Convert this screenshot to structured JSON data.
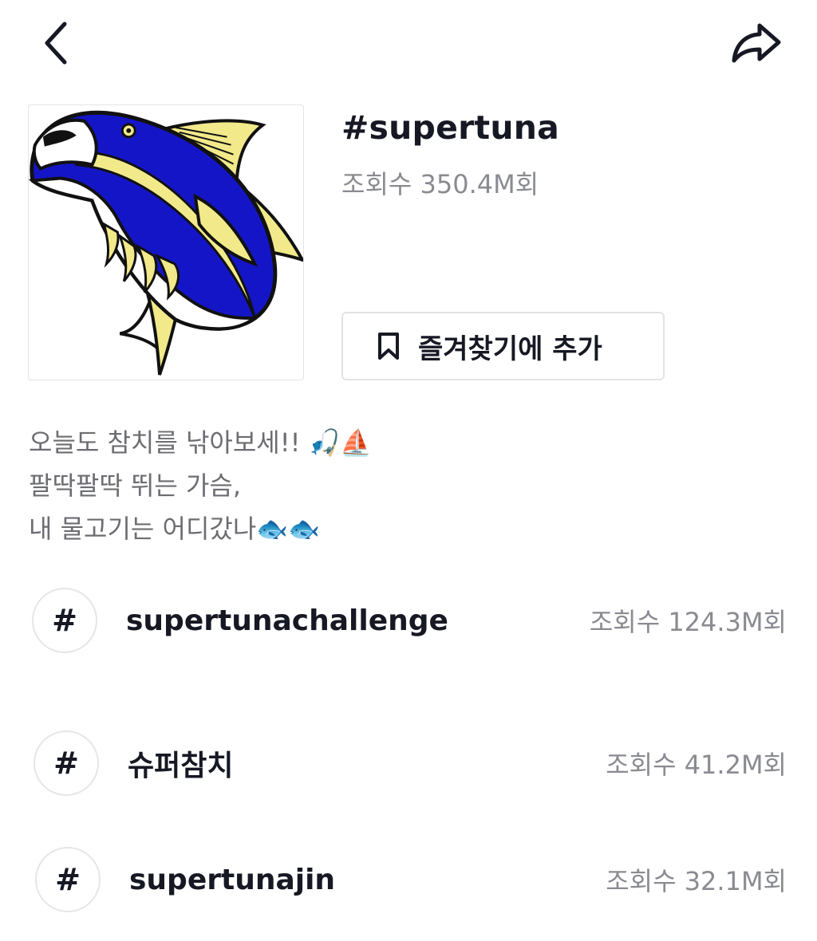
{
  "nav": {
    "back_icon": "chevron-left-icon",
    "share_icon": "share-arrow-icon"
  },
  "hashtag": {
    "title": "#supertuna",
    "views": "조회수 350.4M회",
    "cover_icon": "tuna-fish-illustration"
  },
  "favorite": {
    "icon": "bookmark-icon",
    "label": "즐겨찾기에 추가"
  },
  "description": {
    "lines": [
      "오늘도 참치를 낚아보세!! 🎣⛵",
      "팔딱팔딱 뛰는 가슴,",
      "내 물고기는 어디갔나🐟🐟"
    ]
  },
  "related": [
    {
      "name": "supertunachallenge",
      "views": "조회수 124.3M회"
    },
    {
      "name": "슈퍼참치",
      "views": "조회수 41.2M회"
    },
    {
      "name": "supertunajin",
      "views": "조회수 32.1M회"
    }
  ],
  "related_icon_symbol": "#",
  "colors": {
    "text_primary": "#161823",
    "text_secondary": "#8a8b91",
    "border": "#e3e3e4",
    "tuna_blue": "#1515c8",
    "tuna_yellow": "#f2ea8a"
  }
}
